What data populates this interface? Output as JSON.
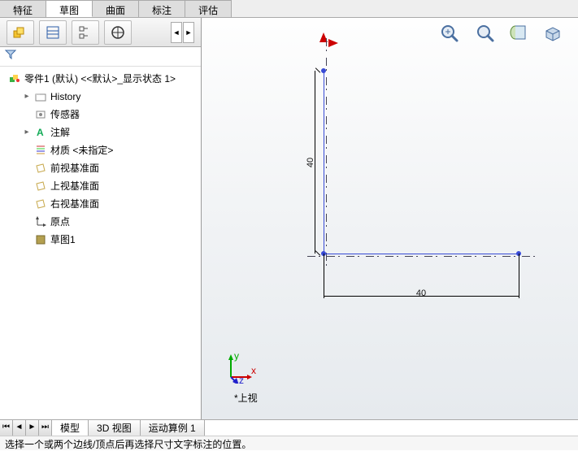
{
  "ribbon": {
    "tabs": [
      "特征",
      "草图",
      "曲面",
      "标注",
      "评估"
    ],
    "active_index": 1
  },
  "tree": {
    "root": "零件1 (默认) <<默认>_显示状态 1>",
    "items": [
      {
        "label": "History",
        "icon": "folder"
      },
      {
        "label": "传感器",
        "icon": "sensor"
      },
      {
        "label": "注解",
        "icon": "annotation",
        "expandable": true
      },
      {
        "label": "材质 <未指定>",
        "icon": "material"
      },
      {
        "label": "前视基准面",
        "icon": "plane"
      },
      {
        "label": "上视基准面",
        "icon": "plane"
      },
      {
        "label": "右视基准面",
        "icon": "plane"
      },
      {
        "label": "原点",
        "icon": "origin"
      },
      {
        "label": "草图1",
        "icon": "sketch"
      }
    ]
  },
  "sketch": {
    "dim_vertical": "40",
    "dim_horizontal": "40"
  },
  "triad": {
    "axes": [
      "x",
      "y",
      "z"
    ]
  },
  "view_name": "*上视",
  "bottom_tabs": {
    "items": [
      "模型",
      "3D 视图",
      "运动算例 1"
    ],
    "active_index": 0
  },
  "status_text": "选择一个或两个边线/顶点后再选择尺寸文字标注的位置。"
}
